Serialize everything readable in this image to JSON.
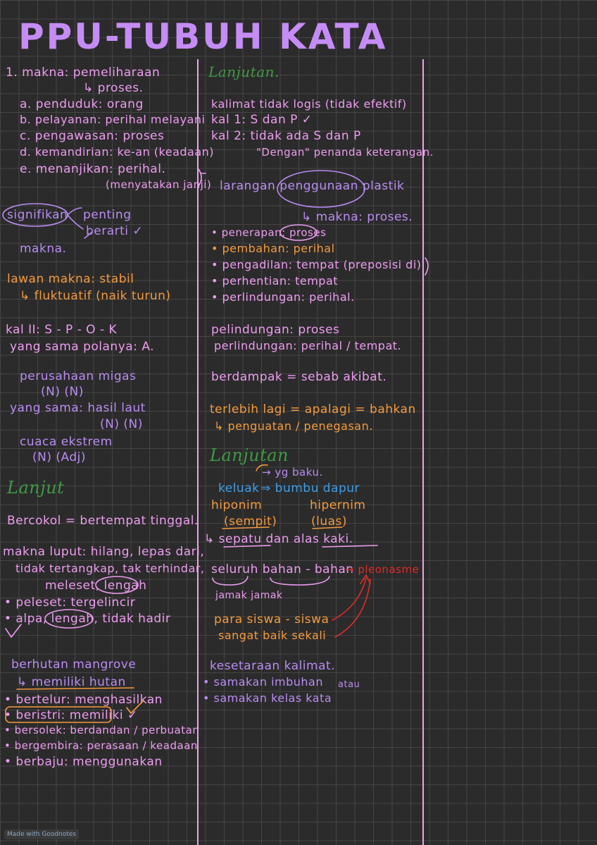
{
  "title": "PPU-TUBUH KATA",
  "left": {
    "l1": "1. makna: pemeliharaan",
    "l2": "↳ proses.",
    "a": "a. penduduk: orang",
    "b": "b. pelayanan: perihal melayani",
    "c": "c. pengawasan: proses",
    "d": "d. kemandirian: ke-an (keadaan)",
    "e": "e. menanjikan: perihal.",
    "e2": "(menyatakan janji)",
    "sig": "signifikan",
    "sig_p": "penting",
    "sig_b": "berarti ✓",
    "makna": "makna.",
    "lawan": "lawan makna: stabil",
    "fluk": "↳ fluktuatif (naik turun)",
    "kal2": "kal II: S - P - O - K",
    "kal2b": "yang sama polanya: A.",
    "per": "perusahaan migas",
    "per_n": "(N)        (N)",
    "hasil": "yang sama: hasil laut",
    "hasil_n": "(N) (N)",
    "cuaca": "cuaca ekstrem",
    "cuaca_n": "(N)    (Adj)",
    "lanjut": "Lanjut",
    "bercokol": "Bercokol = bertempat tinggal.",
    "luput1": "makna luput: hilang, lepas dari,",
    "luput2": "tidak tertangkap, tak terhindar,",
    "luput3": "meleset, lengah",
    "peleset": "• peleset: tergelincir",
    "alpa": "• alpa, lengah, tidak hadir",
    "hutan": "berhutan mangrove",
    "hutan2": "↳ memiliki hutan",
    "bt": "• bertelur: menghasilkan",
    "bs": "• beristri: memiliki ✓",
    "bso": "• bersolek: berdandan / perbuatan",
    "bg": "• bergembira: perasaan / keadaan",
    "bb": "• berbaju: menggunakan"
  },
  "right": {
    "lanjutan": "Lanjutan.",
    "kal": "kalimat tidak logis (tidak efektif)",
    "kal1": "kal 1: S dan P ✓",
    "kal2": "kal 2: tidak ada S dan P",
    "dengan": "\"Dengan\" penanda keterangan.",
    "lar": "larangan penggunaan plastik",
    "lar2": "↳ makna: proses.",
    "p1": "• penerapan: proses",
    "p2": "• pembahan: perihal",
    "p3": "• pengadilan: tempat (preposisi di)",
    "p4": "• perhentian: tempat",
    "p5": "• perlindungan: perihal.",
    "pl1": "pelindungan: proses",
    "pl2": "perlindungan: perihal / tempat.",
    "ber": "berdampak = sebab akibat.",
    "ter": "terlebih lagi = apalagi = bahkan",
    "ter2": "↳ penguatan / penegasan.",
    "lanjutan2": "Lanjutan",
    "baku": "→ yg baku.",
    "keluak": "keluak",
    "bumbu": "⇒ bumbu dapur",
    "hiponim": "hiponim",
    "hipernim": "hipernim",
    "sempit": "(sempit)",
    "luas": "(luas)",
    "sepatu": "↳ sepatu  dan  alas kaki.",
    "seluruh": "seluruh  bahan - bahan",
    "pleo": "→ pleonasme",
    "jamak": "jamak          jamak",
    "para": "para siswa - siswa",
    "sangat": "sangat baik sekali",
    "kes": "kesetaraan kalimat.",
    "s1": "• samakan imbuhan",
    "atau": "atau",
    "s2": "• samakan kelas kata"
  },
  "footer": "Made with Goodnotes",
  "colors": {
    "background": "#2b2b2b",
    "grid": "#454545",
    "pink": "#ee9cf0",
    "orange": "#f49a3e",
    "purple": "#b98cf2",
    "green": "#3f9a45",
    "blue": "#3e9ee8",
    "red": "#e12a2a"
  }
}
